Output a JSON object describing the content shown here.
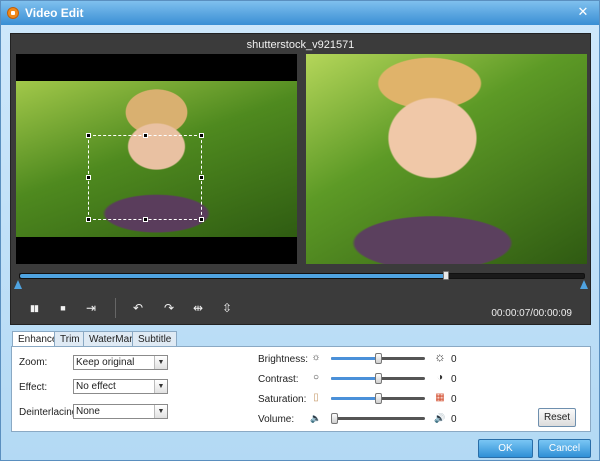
{
  "window": {
    "title": "Video Edit",
    "close_glyph": "✕"
  },
  "player": {
    "filename": "shutterstock_v921571",
    "progress_fraction": 0.755,
    "timecode": "00:00:07/00:00:09",
    "controls": {
      "pause": "▮▮",
      "stop": "■",
      "crop": "⇥",
      "rotate_left": "↶",
      "rotate_right": "↷",
      "flip_horizontal": "⇹",
      "flip_vertical": "⇳"
    }
  },
  "tabs": [
    {
      "label": "Enhance",
      "active": true
    },
    {
      "label": "Trim",
      "active": false
    },
    {
      "label": "WaterMark",
      "active": false
    },
    {
      "label": "Subtitle",
      "active": false
    }
  ],
  "enhance": {
    "zoom": {
      "label": "Zoom:",
      "value": "Keep original"
    },
    "effect": {
      "label": "Effect:",
      "value": "No effect"
    },
    "deinterlacing": {
      "label": "Deinterlacing:",
      "value": "None"
    },
    "brightness": {
      "label": "Brightness:",
      "value": "0",
      "level": 0.5,
      "icon_min": "☼",
      "icon_max": "☼"
    },
    "contrast": {
      "label": "Contrast:",
      "value": "0",
      "level": 0.5,
      "icon_min": "○",
      "icon_max": "◑"
    },
    "saturation": {
      "label": "Saturation:",
      "value": "0",
      "level": 0.5,
      "icon_min": "▯",
      "icon_max": "▦"
    },
    "volume": {
      "label": "Volume:",
      "value": "0",
      "level": 0.0,
      "icon_min": "🔈",
      "icon_max": "🔊"
    },
    "reset_label": "Reset"
  },
  "buttons": {
    "ok": "OK",
    "cancel": "Cancel"
  },
  "colors": {
    "accent": "#2f8fd6",
    "progress": "#4fa3e0"
  }
}
